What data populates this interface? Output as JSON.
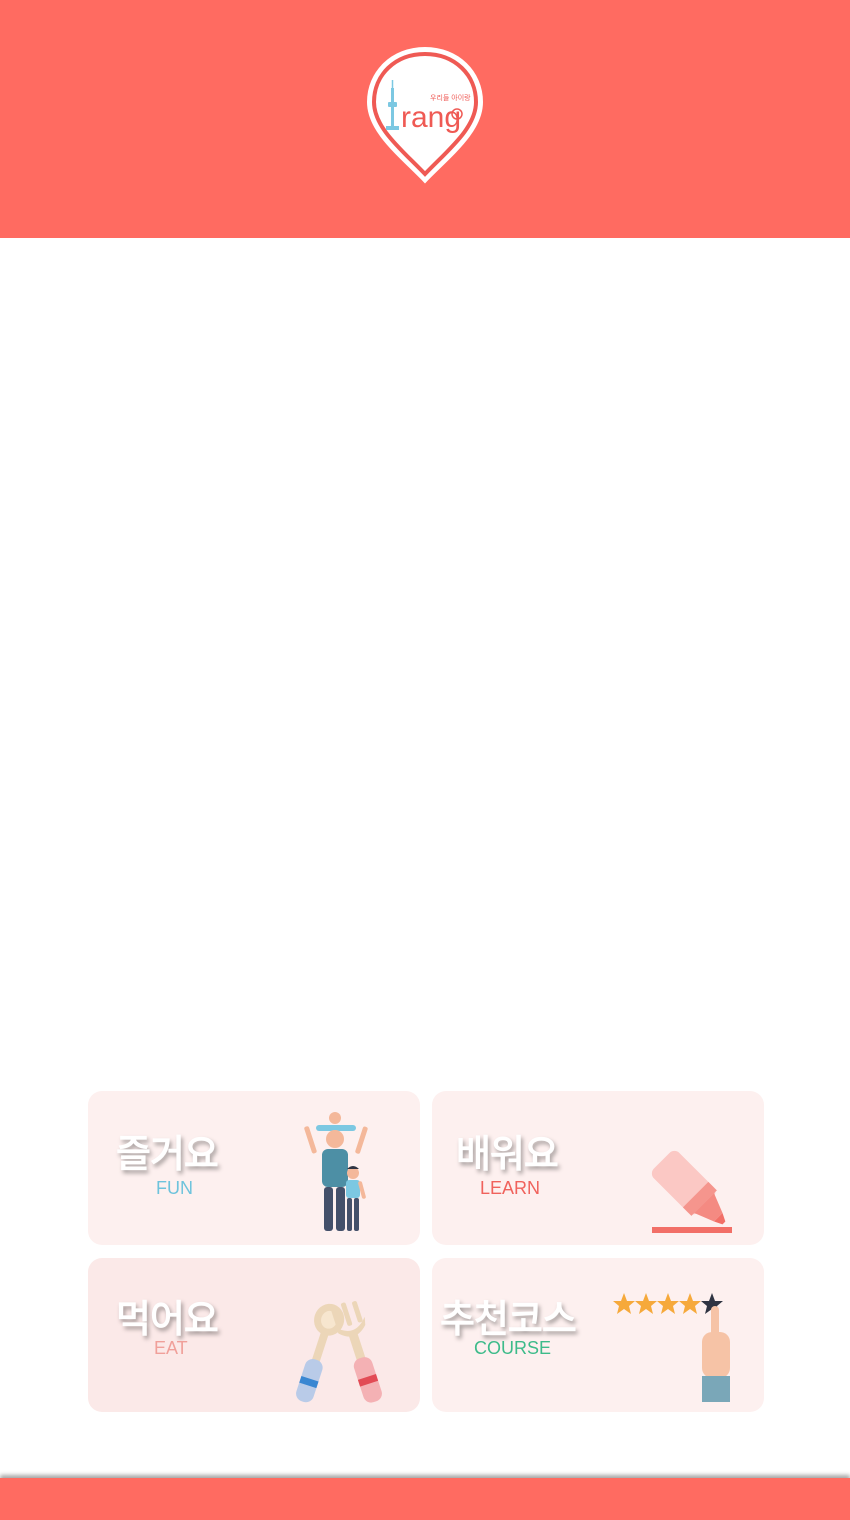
{
  "header": {
    "logo_text": "rang",
    "logo_tagline": "우리들 아이랑",
    "logo_icon": "seoul-tower-pin-icon",
    "color": "#ff6b61"
  },
  "menu": [
    {
      "title": "즐거요",
      "subtitle": "FUN",
      "icon": "family-icon",
      "bg": "#fdf0ef",
      "sub_color": "#6ec3dc"
    },
    {
      "title": "배워요",
      "subtitle": "LEARN",
      "icon": "marker-pen-icon",
      "bg": "#fdf0ef",
      "sub_color": "#f0625c"
    },
    {
      "title": "먹어요",
      "subtitle": "EAT",
      "icon": "spoon-fork-icon",
      "bg": "#fbe9e8",
      "sub_color": "#f0a09a"
    },
    {
      "title": "추천코스",
      "subtitle": "COURSE",
      "icon": "rating-stars-hand-icon",
      "bg": "#fdf0ef",
      "sub_color": "#3dbb8a"
    }
  ]
}
